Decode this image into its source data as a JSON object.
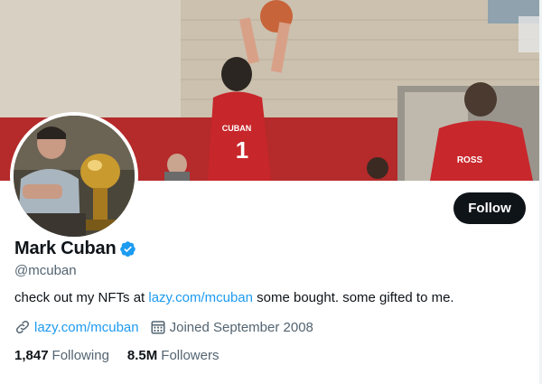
{
  "colors": {
    "accent": "#1d9bf0",
    "primary_text": "#0f1419",
    "secondary_text": "#536471",
    "follow_button_bg": "#0f1419",
    "follow_button_text": "#ffffff"
  },
  "banner": {
    "description_icon": "banner-image",
    "jersey_left_text": "CUBAN",
    "jersey_left_number": "1",
    "jersey_right_text": "ROSS"
  },
  "profile": {
    "display_name": "Mark Cuban",
    "verified_icon": "verified-badge-icon",
    "handle": "@mcuban",
    "follow_label": "Follow",
    "bio": {
      "before_link": "check out my NFTs at ",
      "link_text": "lazy.com/mcuban",
      "after_link": " some bought. some gifted to me."
    },
    "meta": {
      "website_icon": "link-icon",
      "website": "lazy.com/mcuban",
      "joined_icon": "calendar-icon",
      "joined": "Joined September 2008"
    },
    "stats": {
      "following_count": "1,847",
      "following_label": "Following",
      "followers_count": "8.5M",
      "followers_label": "Followers"
    }
  }
}
